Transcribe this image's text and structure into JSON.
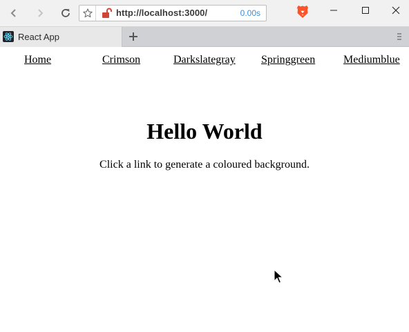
{
  "browser": {
    "url": "http://localhost:3000/",
    "load_time": "0.00s",
    "tab_title": "React App",
    "icons": {
      "back": "back-arrow-icon",
      "forward": "forward-arrow-icon",
      "reload": "reload-icon",
      "bookmark": "star-icon",
      "security": "unlocked-lock-icon",
      "shields": "brave-lion-icon",
      "minimize": "minimize-icon",
      "maximize": "maximize-icon",
      "close": "close-icon",
      "new_tab": "plus-icon",
      "tab_menu": "hamburger-icon",
      "favicon": "react-logo-icon"
    },
    "colors": {
      "brave_orange": "#fb542b",
      "lock_red": "#d0453a",
      "load_time_blue": "#3b8ed8"
    }
  },
  "nav": {
    "links": [
      "Home",
      "Crimson",
      "Darkslategray",
      "Springgreen",
      "Mediumblue"
    ]
  },
  "main": {
    "heading": "Hello World",
    "subtext": "Click a link to generate a coloured background."
  }
}
